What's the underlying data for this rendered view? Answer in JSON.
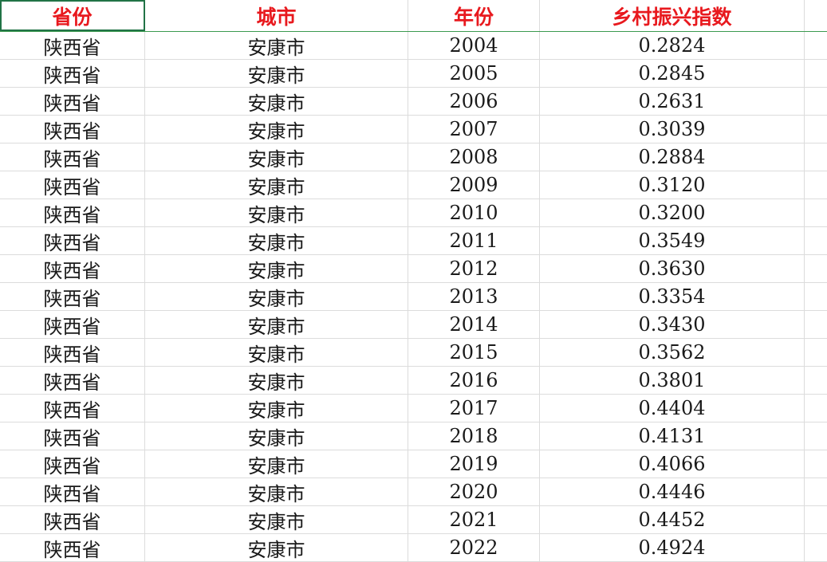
{
  "columns": [
    "省份",
    "城市",
    "年份",
    "乡村振兴指数"
  ],
  "rows": [
    [
      "陕西省",
      "安康市",
      "2004",
      "0.2824"
    ],
    [
      "陕西省",
      "安康市",
      "2005",
      "0.2845"
    ],
    [
      "陕西省",
      "安康市",
      "2006",
      "0.2631"
    ],
    [
      "陕西省",
      "安康市",
      "2007",
      "0.3039"
    ],
    [
      "陕西省",
      "安康市",
      "2008",
      "0.2884"
    ],
    [
      "陕西省",
      "安康市",
      "2009",
      "0.3120"
    ],
    [
      "陕西省",
      "安康市",
      "2010",
      "0.3200"
    ],
    [
      "陕西省",
      "安康市",
      "2011",
      "0.3549"
    ],
    [
      "陕西省",
      "安康市",
      "2012",
      "0.3630"
    ],
    [
      "陕西省",
      "安康市",
      "2013",
      "0.3354"
    ],
    [
      "陕西省",
      "安康市",
      "2014",
      "0.3430"
    ],
    [
      "陕西省",
      "安康市",
      "2015",
      "0.3562"
    ],
    [
      "陕西省",
      "安康市",
      "2016",
      "0.3801"
    ],
    [
      "陕西省",
      "安康市",
      "2017",
      "0.4404"
    ],
    [
      "陕西省",
      "安康市",
      "2018",
      "0.4131"
    ],
    [
      "陕西省",
      "安康市",
      "2019",
      "0.4066"
    ],
    [
      "陕西省",
      "安康市",
      "2020",
      "0.4446"
    ],
    [
      "陕西省",
      "安康市",
      "2021",
      "0.4452"
    ],
    [
      "陕西省",
      "安康市",
      "2022",
      "0.4924"
    ]
  ],
  "colors": {
    "header_text": "#e8191e",
    "gridline": "#dcdcdc",
    "selection": "#217346"
  }
}
